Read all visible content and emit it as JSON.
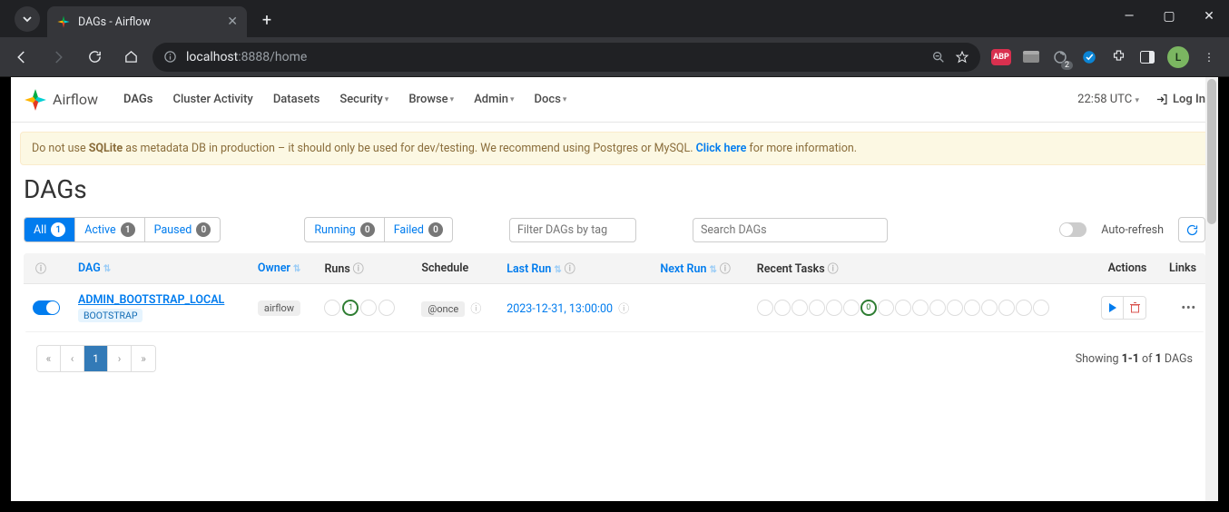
{
  "browser": {
    "tab_title": "DAGs - Airflow",
    "url_prefix": "localhost",
    "url_port": ":8888",
    "url_path": "/home",
    "abp": "ABP",
    "avatar_initial": "L"
  },
  "navbar": {
    "brand": "Airflow",
    "items": [
      "DAGs",
      "Cluster Activity",
      "Datasets",
      "Security",
      "Browse",
      "Admin",
      "Docs"
    ],
    "has_dropdown": [
      false,
      false,
      false,
      true,
      true,
      true,
      true
    ],
    "time": "22:58 UTC",
    "login": "Log In"
  },
  "alert": {
    "pre": "Do not use ",
    "bold": "SQLite",
    "mid": " as metadata DB in production – it should only be used for dev/testing. We recommend using Postgres or MySQL. ",
    "cta": "Click here",
    "post": " for more information."
  },
  "page": {
    "title": "DAGs"
  },
  "toolbar": {
    "status_filters": [
      {
        "label": "All",
        "count": "1",
        "selected": true
      },
      {
        "label": "Active",
        "count": "1",
        "selected": false
      },
      {
        "label": "Paused",
        "count": "0",
        "selected": false
      }
    ],
    "state_filters": [
      {
        "label": "Running",
        "count": "0"
      },
      {
        "label": "Failed",
        "count": "0"
      }
    ],
    "filter_tags_placeholder": "Filter DAGs by tag",
    "search_placeholder": "Search DAGs",
    "autorefresh": "Auto-refresh"
  },
  "table": {
    "headers": {
      "dag": "DAG",
      "owner": "Owner",
      "runs": "Runs",
      "schedule": "Schedule",
      "last_run": "Last Run",
      "next_run": "Next Run",
      "recent_tasks": "Recent Tasks",
      "actions": "Actions",
      "links": "Links"
    },
    "rows": [
      {
        "dag_id": "ADMIN_BOOTSTRAP_LOCAL",
        "tag": "BOOTSTRAP",
        "owner": "airflow",
        "runs_success": "1",
        "schedule": "@once",
        "last_run": "2023-12-31, 13:00:00",
        "task_ok": "0"
      }
    ]
  },
  "footer": {
    "showing_pre": "Showing ",
    "range": "1-1",
    "of": " of ",
    "total": "1",
    "suffix": " DAGs",
    "pages": [
      "«",
      "‹",
      "1",
      "›",
      "»"
    ],
    "active_page": "1"
  }
}
